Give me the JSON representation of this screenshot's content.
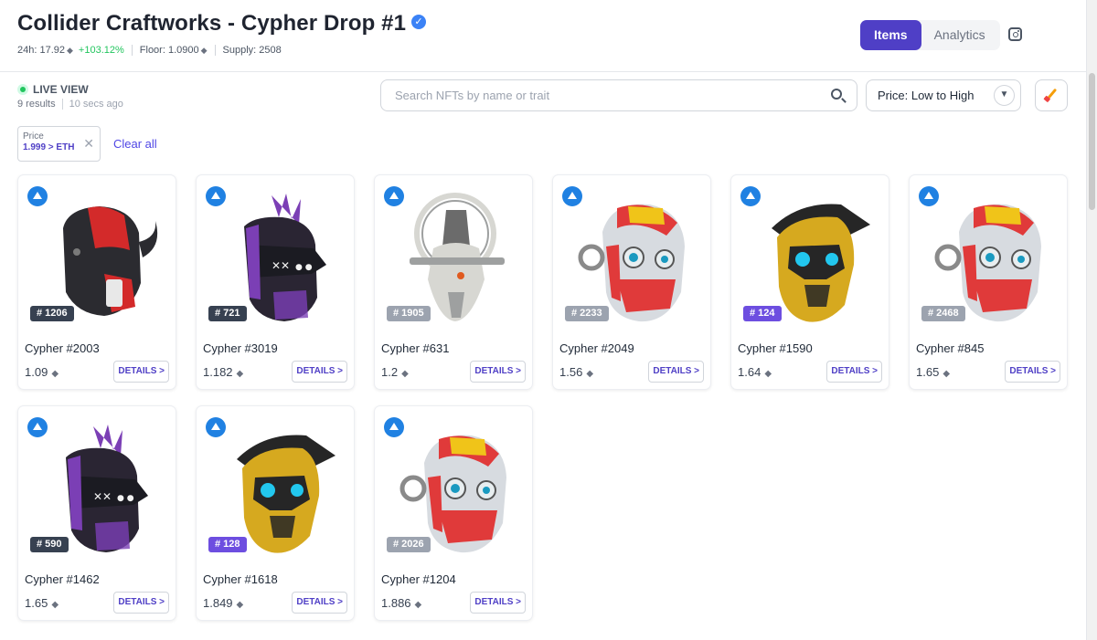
{
  "header": {
    "title": "Collider Craftworks - Cypher Drop #1",
    "verified_icon": "check-icon",
    "stats": {
      "volume_24h": "24h: 17.92",
      "change": "+103.12%",
      "floor": "Floor: 1.0900",
      "supply": "Supply: 2508"
    },
    "eth_symbol": "◆",
    "tabs": [
      {
        "label": "Items",
        "active": true
      },
      {
        "label": "Analytics",
        "active": false
      }
    ],
    "social_icon": "instagram-icon"
  },
  "status": {
    "live_label": "LIVE VIEW",
    "results": "9 results",
    "updated": "10 secs ago"
  },
  "search": {
    "placeholder": "Search NFTs by name or trait"
  },
  "sort": {
    "label": "Price: Low to High"
  },
  "filters": {
    "chip_label": "Price",
    "chip_value": "1.999 > ETH",
    "clear_label": "Clear all"
  },
  "colors": {
    "accent": "#4f3fc6",
    "live": "#22c55e",
    "opensea": "#2081e2"
  },
  "items": [
    {
      "rank": "# 1206",
      "name": "Cypher #2003",
      "price": "1.09",
      "details": "DETAILS >",
      "rank_style": "dark",
      "variant": "horned",
      "palette": [
        "#2b2b30",
        "#d32a2a",
        "#e8e8e8"
      ]
    },
    {
      "rank": "# 721",
      "name": "Cypher #3019",
      "price": "1.182",
      "details": "DETAILS >",
      "rank_style": "dark",
      "variant": "visor",
      "palette": [
        "#2a2533",
        "#7b3fb5",
        "#f2f2f2"
      ]
    },
    {
      "rank": "# 1905",
      "name": "Cypher #631",
      "price": "1.2",
      "details": "DETAILS >",
      "rank_style": "gray",
      "variant": "ring",
      "palette": [
        "#d7d7d2",
        "#9ea0a0",
        "#6b6b6b"
      ]
    },
    {
      "rank": "# 2233",
      "name": "Cypher #2049",
      "price": "1.56",
      "details": "DETAILS >",
      "rank_style": "gray",
      "variant": "monkey",
      "palette": [
        "#d7dbe0",
        "#e03a3a",
        "#f0c419"
      ]
    },
    {
      "rank": "# 124",
      "name": "Cypher #1590",
      "price": "1.64",
      "details": "DETAILS >",
      "rank_style": "purple",
      "variant": "gold",
      "palette": [
        "#d6a91f",
        "#262626",
        "#22c7ee"
      ]
    },
    {
      "rank": "# 2468",
      "name": "Cypher #845",
      "price": "1.65",
      "details": "DETAILS >",
      "rank_style": "gray",
      "variant": "monkey",
      "palette": [
        "#d7dbe0",
        "#e03a3a",
        "#f0c419"
      ]
    },
    {
      "rank": "# 590",
      "name": "Cypher #1462",
      "price": "1.65",
      "details": "DETAILS >",
      "rank_style": "dark",
      "variant": "visor",
      "palette": [
        "#2a2533",
        "#7b3fb5",
        "#f2f2f2"
      ]
    },
    {
      "rank": "# 128",
      "name": "Cypher #1618",
      "price": "1.849",
      "details": "DETAILS >",
      "rank_style": "purple",
      "variant": "gold",
      "palette": [
        "#d6a91f",
        "#262626",
        "#22c7ee"
      ]
    },
    {
      "rank": "# 2026",
      "name": "Cypher #1204",
      "price": "1.886",
      "details": "DETAILS >",
      "rank_style": "gray",
      "variant": "monkey",
      "palette": [
        "#d7dbe0",
        "#e03a3a",
        "#f0c419"
      ]
    }
  ]
}
